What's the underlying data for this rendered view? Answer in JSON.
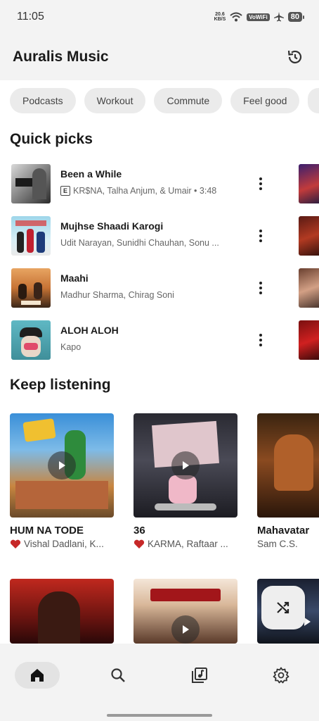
{
  "status_bar": {
    "time": "11:05",
    "net_speed_top": "20.6",
    "net_speed_bottom": "KB/S",
    "vowifi": "VoWiFi",
    "battery": "80"
  },
  "header": {
    "title": "Auralis Music",
    "history_icon": "history-icon"
  },
  "chips": [
    "Podcasts",
    "Workout",
    "Commute",
    "Feel good"
  ],
  "quick_picks": {
    "title": "Quick picks",
    "items": [
      {
        "title": "Been a While",
        "explicit": true,
        "explicit_label": "E",
        "subtitle": "KR$NA, Talha Anjum, & Umair • 3:48"
      },
      {
        "title": "Mujhse Shaadi Karogi",
        "explicit": false,
        "subtitle": "Udit Narayan, Sunidhi Chauhan, Sonu ..."
      },
      {
        "title": "Maahi",
        "explicit": false,
        "subtitle": "Madhur Sharma, Chirag Soni"
      },
      {
        "title": "ALOH ALOH",
        "explicit": false,
        "subtitle": "Kapo"
      }
    ]
  },
  "keep_listening": {
    "title": "Keep listening",
    "items": [
      {
        "title": "HUM NA TODE",
        "liked": true,
        "subtitle": "Vishal Dadlani, K..."
      },
      {
        "title": "36",
        "liked": true,
        "subtitle": "KARMA, Raftaar ..."
      },
      {
        "title": "Mahavatar",
        "liked": false,
        "subtitle": "Sam C.S."
      }
    ]
  },
  "colors": {
    "accent_heart": "#c62828",
    "background": "#f3f3f3",
    "surface": "#ffffff"
  },
  "nav": [
    "home-icon",
    "search-icon",
    "library-icon",
    "settings-icon"
  ]
}
